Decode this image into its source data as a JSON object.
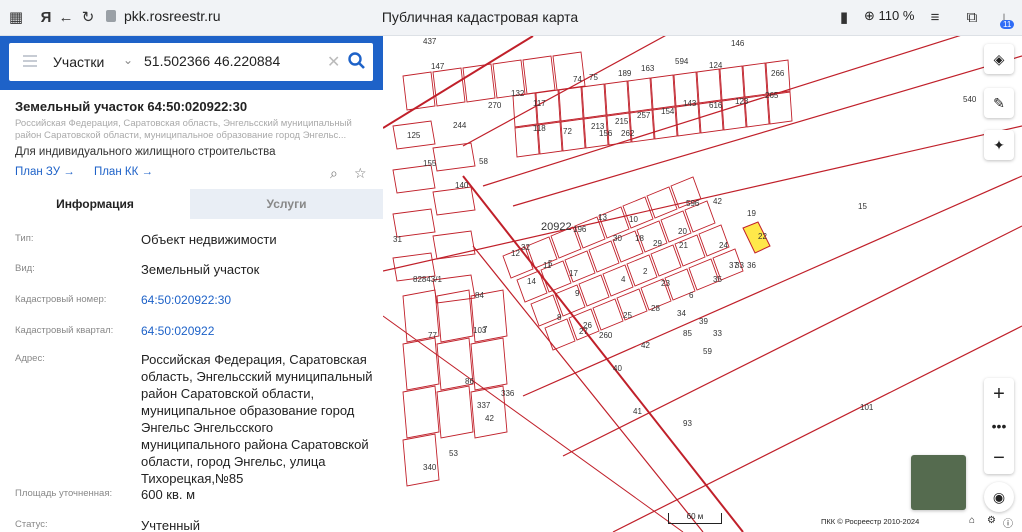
{
  "browser": {
    "url": "pkk.rosreestr.ru",
    "title": "Публичная кадастровая карта",
    "zoom": "110 %",
    "badge": "11"
  },
  "search": {
    "type": "Участки",
    "query": "51.502366 46.220884"
  },
  "parcel": {
    "title": "Земельный участок 64:50:020922:30",
    "address_short": "Российская Федерация, Саратовская область, Энгельсский муниципальный район Саратовской области, муниципальное образование город Энгельс...",
    "purpose": "Для индивидуального жилищного строительства",
    "link_plan_zu": "План ЗУ →",
    "link_plan_kk": "План КК →"
  },
  "tabs": {
    "info": "Информация",
    "services": "Услуги"
  },
  "rows": [
    {
      "label": "Тип:",
      "value": "Объект недвижимости"
    },
    {
      "label": "Вид:",
      "value": "Земельный участок"
    },
    {
      "label": "Кадастровый номер:",
      "value": "64:50:020922:30"
    },
    {
      "label": "Кадастровый квартал:",
      "value": "64:50:020922"
    },
    {
      "label": "Адрес:",
      "value": "Российская Федерация, Саратовская область, Энгельсский муниципальный район Саратовской области, муниципальное образование город Энгельс Энгельсского муниципального района Саратовской области, город Энгельс, улица Тихорецкая,№85"
    },
    {
      "label": "Площадь уточненная:",
      "value": "600 кв. м"
    },
    {
      "label": "Статус:",
      "value": "Учтенный"
    }
  ],
  "map": {
    "scale": "60 м",
    "copyright": "ПКК © Росреестр 2010-2024",
    "block_label": "20922",
    "labels": [
      "437",
      "147",
      "117",
      "74",
      "75",
      "189",
      "163",
      "594",
      "124",
      "146",
      "266",
      "265",
      "270",
      "132",
      "118",
      "72",
      "213",
      "215",
      "257",
      "154",
      "143",
      "616",
      "123",
      "155",
      "125",
      "244",
      "58",
      "140",
      "156",
      "262",
      "540",
      "596",
      "42",
      "19",
      "15",
      "31",
      "20922",
      "196",
      "13",
      "10",
      "29",
      "20",
      "22",
      "30",
      "18",
      "21",
      "24",
      "33",
      "32",
      "5",
      "11",
      "12",
      "17",
      "9",
      "4",
      "2",
      "23",
      "28",
      "6",
      "35",
      "37",
      "36",
      "82843/1",
      "14",
      "8",
      "25",
      "26",
      "34",
      "39",
      "33",
      "85",
      "7",
      "27",
      "260",
      "40",
      "42",
      "59",
      "77",
      "84",
      "103",
      "86",
      "336",
      "337",
      "42",
      "41",
      "93",
      "101",
      "53",
      "340"
    ]
  }
}
